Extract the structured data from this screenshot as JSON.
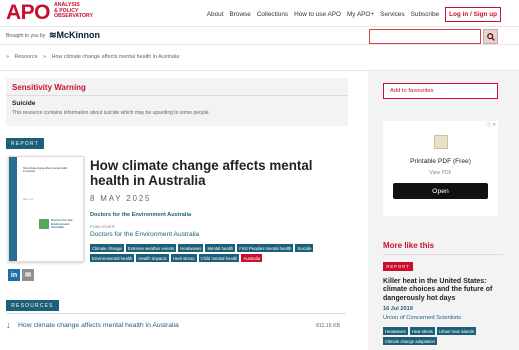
{
  "header": {
    "logo_mark": "APO",
    "logo_line1": "Analysis",
    "logo_line2": "& Policy",
    "logo_line3": "Observatory",
    "nav": [
      "About",
      "Browse",
      "Collections",
      "How to use APO",
      "My APO+",
      "Services",
      "Subscribe"
    ],
    "login_label": "Log in / Sign up"
  },
  "sponsor": {
    "brought_label": "Brought to you by",
    "sponsor_name": "McKinnon"
  },
  "search": {
    "value": "",
    "icon": "search-icon"
  },
  "breadcrumb": [
    "»",
    "Resource",
    "»",
    "How climate change affects mental health in Australia"
  ],
  "warning": {
    "title": "Sensitivity Warning",
    "topic": "Suicide",
    "description": "This resource contains information about suicide which may be upsetting to some people."
  },
  "report": {
    "tag": "REPORT",
    "thumb_title": "How climate change affects mental health in Australia",
    "thumb_date": "MAY 2025",
    "thumb_logo": "Doctors for the Environment Australia",
    "title": "How climate change affects mental health in Australia",
    "date": "8 MAY 2025",
    "author": "Doctors for the Environment Australia",
    "publisher_label": "Publisher",
    "publisher": "Doctors for the Environment Australia",
    "tags": [
      {
        "label": "Climate change",
        "red": false
      },
      {
        "label": "Extreme weather events",
        "red": false
      },
      {
        "label": "Heatwaves",
        "red": false
      },
      {
        "label": "Mental health",
        "red": false
      },
      {
        "label": "First Peoples mental health",
        "red": false
      },
      {
        "label": "Suicide",
        "red": false
      },
      {
        "label": "Environmental health",
        "red": false
      },
      {
        "label": "Health impacts",
        "red": false
      },
      {
        "label": "Heat stress",
        "red": false
      },
      {
        "label": "Child mental health",
        "red": false
      },
      {
        "label": "Australia",
        "red": true
      }
    ]
  },
  "share": {
    "linkedin": "in",
    "email": "✉"
  },
  "resources": {
    "tag": "RESOURCES",
    "file_link": "How climate change affects mental health in Australia",
    "file_size": "811.15 KB",
    "icon": "download-icon"
  },
  "sidebar": {
    "favourite_label": "Add to favourites",
    "ad": {
      "close": "ⓘ ✕",
      "title": "Printable PDF (Free)",
      "subtitle": "View PDF",
      "button": "Open"
    },
    "more_title": "More like this",
    "more_tag": "REPORT",
    "more_headline": "Killer heat in the United States: climate choices and the future of dangerously hot days",
    "more_date": "16 Jul 2019",
    "more_org": "Union of Concerned Scientists",
    "more_tags": [
      "Heatwaves",
      "Heat stress",
      "Urban heat islands",
      "Climate change adaptation"
    ]
  },
  "colors": {
    "brand_red": "#c8102e",
    "teal": "#1c5f79"
  }
}
